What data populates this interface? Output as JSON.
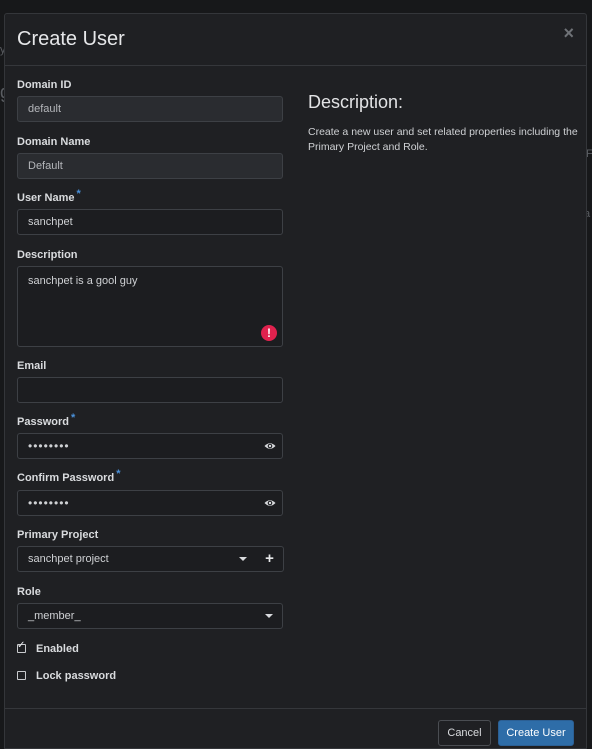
{
  "modal": {
    "title": "Create User",
    "close_glyph": "×"
  },
  "form": {
    "domain_id": {
      "label": "Domain ID",
      "value": "default"
    },
    "domain_name": {
      "label": "Domain Name",
      "value": "Default"
    },
    "user_name": {
      "label": "User Name",
      "required": "*",
      "value": "sanchpet"
    },
    "description": {
      "label": "Description",
      "value": "sanchpet is a gool guy",
      "error_glyph": "!"
    },
    "email": {
      "label": "Email",
      "value": ""
    },
    "password": {
      "label": "Password",
      "required": "*",
      "value": "••••••••"
    },
    "confirm_password": {
      "label": "Confirm Password",
      "required": "*",
      "value": "••••••••"
    },
    "primary_project": {
      "label": "Primary Project",
      "value": "sanchpet project",
      "add_glyph": "+"
    },
    "role": {
      "label": "Role",
      "value": "_member_"
    },
    "enabled": {
      "label": "Enabled",
      "checked": true
    },
    "lock_password": {
      "label": "Lock password",
      "checked": false
    }
  },
  "description_panel": {
    "title": "Description:",
    "text": "Create a new user and set related properties including the Primary Project and Role."
  },
  "footer": {
    "cancel_label": "Cancel",
    "submit_label": "Create User"
  },
  "icons": {
    "close": "close-icon",
    "password_toggle": "eye-icon",
    "dropdown": "caret-down-icon",
    "error": "exclamation-icon",
    "add": "plus-icon"
  },
  "colors": {
    "primary": "#2e6da8",
    "error": "#e0224e",
    "required": "#4a90d9"
  }
}
